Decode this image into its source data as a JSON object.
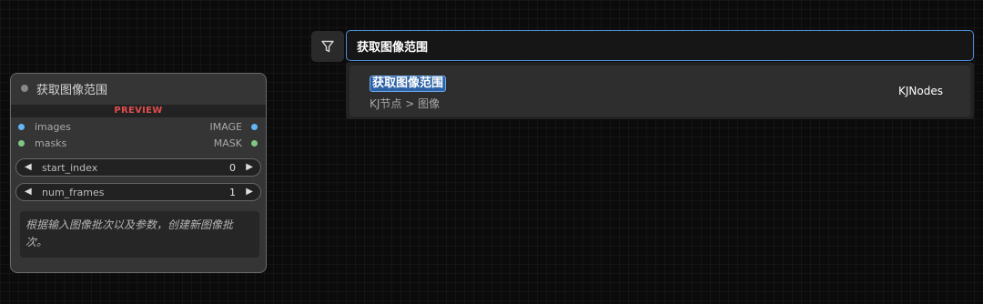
{
  "node": {
    "title": "获取图像范围",
    "preview_label": "PREVIEW",
    "inputs": [
      {
        "label": "images",
        "color": "#64b5f6"
      },
      {
        "label": "masks",
        "color": "#81c784"
      }
    ],
    "outputs": [
      {
        "label": "IMAGE",
        "color": "#64b5f6"
      },
      {
        "label": "MASK",
        "color": "#81c784"
      }
    ],
    "widgets": [
      {
        "name": "start_index",
        "value": "0"
      },
      {
        "name": "num_frames",
        "value": "1"
      }
    ],
    "description": "根据输入图像批次以及参数，创建新图像批次。"
  },
  "search": {
    "filter_icon": "filter-icon",
    "query": "获取图像范围",
    "results": [
      {
        "name": "获取图像范围",
        "category": "KJ节点 > 图像",
        "source": "KJNodes"
      }
    ]
  },
  "colors": {
    "accent": "#4d8fd6",
    "preview_red": "#e34c4c",
    "input_blue": "#64b5f6",
    "input_green": "#81c784"
  }
}
